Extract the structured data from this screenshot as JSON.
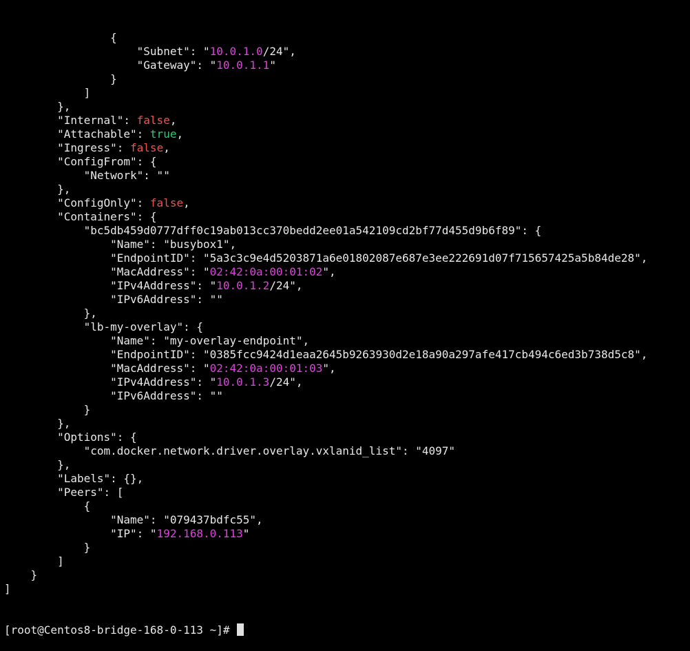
{
  "terminal": {
    "prompt": "[root@Centos8-bridge-168-0-113 ~]# ",
    "colors": {
      "background": "#000000",
      "text": "#e8e8e8",
      "address": "#e040e0",
      "false": "#ef5350",
      "true": "#2ecc71",
      "cursor": "#e0e0e0"
    },
    "lines": [
      [
        {
          "t": "                {",
          "c": "plain"
        }
      ],
      [
        {
          "t": "                    \"Subnet\": \"",
          "c": "plain"
        },
        {
          "t": "10.0.1.0",
          "c": "magenta"
        },
        {
          "t": "/24\",",
          "c": "plain"
        }
      ],
      [
        {
          "t": "                    \"Gateway\": \"",
          "c": "plain"
        },
        {
          "t": "10.0.1.1",
          "c": "magenta"
        },
        {
          "t": "\"",
          "c": "plain"
        }
      ],
      [
        {
          "t": "                }",
          "c": "plain"
        }
      ],
      [
        {
          "t": "            ]",
          "c": "plain"
        }
      ],
      [
        {
          "t": "        },",
          "c": "plain"
        }
      ],
      [
        {
          "t": "        \"Internal\": ",
          "c": "plain"
        },
        {
          "t": "false",
          "c": "red"
        },
        {
          "t": ",",
          "c": "plain"
        }
      ],
      [
        {
          "t": "        \"Attachable\": ",
          "c": "plain"
        },
        {
          "t": "true",
          "c": "green"
        },
        {
          "t": ",",
          "c": "plain"
        }
      ],
      [
        {
          "t": "        \"Ingress\": ",
          "c": "plain"
        },
        {
          "t": "false",
          "c": "red"
        },
        {
          "t": ",",
          "c": "plain"
        }
      ],
      [
        {
          "t": "        \"ConfigFrom\": {",
          "c": "plain"
        }
      ],
      [
        {
          "t": "            \"Network\": \"\"",
          "c": "plain"
        }
      ],
      [
        {
          "t": "        },",
          "c": "plain"
        }
      ],
      [
        {
          "t": "        \"ConfigOnly\": ",
          "c": "plain"
        },
        {
          "t": "false",
          "c": "red"
        },
        {
          "t": ",",
          "c": "plain"
        }
      ],
      [
        {
          "t": "        \"Containers\": {",
          "c": "plain"
        }
      ],
      [
        {
          "t": "            \"bc5db459d0777dff0c19ab013cc370bedd2ee01a542109cd2bf77d455d9b6f89\": {",
          "c": "plain"
        }
      ],
      [
        {
          "t": "                \"Name\": \"busybox1\",",
          "c": "plain"
        }
      ],
      [
        {
          "t": "                \"EndpointID\": \"5a3c3c9e4d5203871a6e01802087e687e3ee222691d07f715657425a5b84de28\",",
          "c": "plain"
        }
      ],
      [
        {
          "t": "                \"MacAddress\": \"",
          "c": "plain"
        },
        {
          "t": "02:42:0a:00:01:02",
          "c": "magenta"
        },
        {
          "t": "\",",
          "c": "plain"
        }
      ],
      [
        {
          "t": "                \"IPv4Address\": \"",
          "c": "plain"
        },
        {
          "t": "10.0.1.2",
          "c": "magenta"
        },
        {
          "t": "/24\",",
          "c": "plain"
        }
      ],
      [
        {
          "t": "                \"IPv6Address\": \"\"",
          "c": "plain"
        }
      ],
      [
        {
          "t": "            },",
          "c": "plain"
        }
      ],
      [
        {
          "t": "            \"lb-my-overlay\": {",
          "c": "plain"
        }
      ],
      [
        {
          "t": "                \"Name\": \"my-overlay-endpoint\",",
          "c": "plain"
        }
      ],
      [
        {
          "t": "                \"EndpointID\": \"0385fcc9424d1eaa2645b9263930d2e18a90a297afe417cb494c6ed3b738d5c8\",",
          "c": "plain"
        }
      ],
      [
        {
          "t": "                \"MacAddress\": \"",
          "c": "plain"
        },
        {
          "t": "02:42:0a:00:01:03",
          "c": "magenta"
        },
        {
          "t": "\",",
          "c": "plain"
        }
      ],
      [
        {
          "t": "                \"IPv4Address\": \"",
          "c": "plain"
        },
        {
          "t": "10.0.1.3",
          "c": "magenta"
        },
        {
          "t": "/24\",",
          "c": "plain"
        }
      ],
      [
        {
          "t": "                \"IPv6Address\": \"\"",
          "c": "plain"
        }
      ],
      [
        {
          "t": "            }",
          "c": "plain"
        }
      ],
      [
        {
          "t": "        },",
          "c": "plain"
        }
      ],
      [
        {
          "t": "        \"Options\": {",
          "c": "plain"
        }
      ],
      [
        {
          "t": "            \"com.docker.network.driver.overlay.vxlanid_list\": \"4097\"",
          "c": "plain"
        }
      ],
      [
        {
          "t": "        },",
          "c": "plain"
        }
      ],
      [
        {
          "t": "        \"Labels\": {},",
          "c": "plain"
        }
      ],
      [
        {
          "t": "        \"Peers\": [",
          "c": "plain"
        }
      ],
      [
        {
          "t": "            {",
          "c": "plain"
        }
      ],
      [
        {
          "t": "                \"Name\": \"079437bdfc55\",",
          "c": "plain"
        }
      ],
      [
        {
          "t": "                \"IP\": \"",
          "c": "plain"
        },
        {
          "t": "192.168.0.113",
          "c": "magenta"
        },
        {
          "t": "\"",
          "c": "plain"
        }
      ],
      [
        {
          "t": "            }",
          "c": "plain"
        }
      ],
      [
        {
          "t": "        ]",
          "c": "plain"
        }
      ],
      [
        {
          "t": "    }",
          "c": "plain"
        }
      ],
      [
        {
          "t": "]",
          "c": "plain"
        }
      ]
    ]
  }
}
